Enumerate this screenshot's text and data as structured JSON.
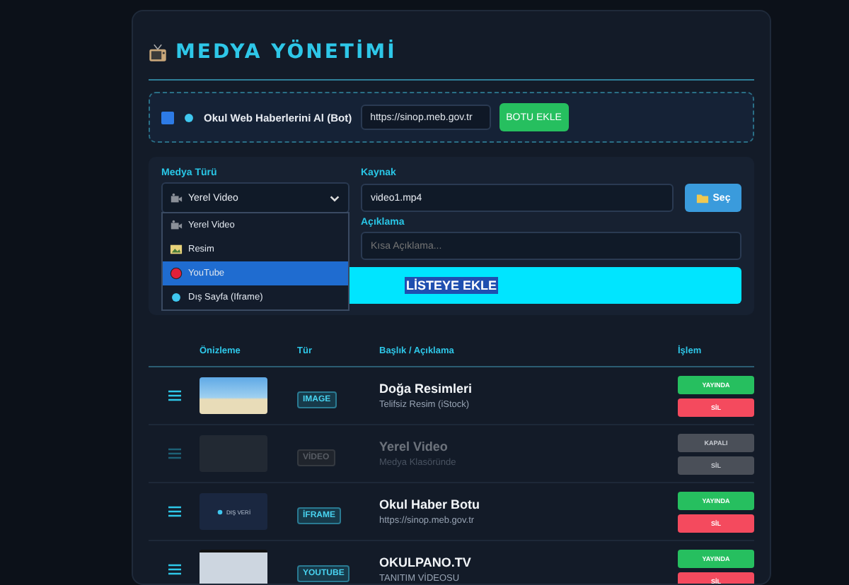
{
  "title": "MEDYA YÖNETİMİ",
  "bot": {
    "checked": true,
    "label": "Okul Web Haberlerini Al (Bot)",
    "url": "https://sinop.meb.gov.tr",
    "button": "BOTU EKLE"
  },
  "form": {
    "type_label": "Medya Türü",
    "type_value": {
      "kind": "video",
      "label": "Yerel Video"
    },
    "source_label": "Kaynak",
    "source_value": "video1.mp4",
    "pick_button": "Seç",
    "desc_label": "Açıklama",
    "desc_placeholder": "Kısa Açıklama...",
    "submit": "LİSTEYE EKLE",
    "options": [
      {
        "kind": "video",
        "label": "Yerel Video",
        "selected": false
      },
      {
        "kind": "image",
        "label": "Resim",
        "selected": false
      },
      {
        "kind": "youtube",
        "label": "YouTube",
        "selected": true
      },
      {
        "kind": "iframe",
        "label": "Dış Sayfa (Iframe)",
        "selected": false
      }
    ]
  },
  "table": {
    "columns": [
      "Önizleme",
      "Tür",
      "Başlık / Açıklama",
      "İşlem"
    ],
    "rows": [
      {
        "kind": "image",
        "type": "IMAGE",
        "title": "Doğa Resimleri",
        "desc": "Telifsiz Resim (iStock)",
        "active": true,
        "status": "YAYINDA",
        "delete": "SİL"
      },
      {
        "kind": "video",
        "type": "VİDEO",
        "title": "Yerel Video",
        "desc": "Medya Klasöründe",
        "active": false,
        "status": "KAPALI",
        "delete": "SİL"
      },
      {
        "kind": "iframe",
        "type": "İFRAME",
        "title": "Okul Haber Botu",
        "desc": "https://sinop.meb.gov.tr",
        "active": true,
        "status": "YAYINDA",
        "delete": "SİL",
        "preview_text": "DIŞ VERİ"
      },
      {
        "kind": "youtube",
        "type": "YOUTUBE",
        "title": "OKULPANO.TV",
        "desc": "TANITIM VİDEOSU",
        "active": true,
        "status": "YAYINDA",
        "delete": "SİL"
      }
    ]
  }
}
